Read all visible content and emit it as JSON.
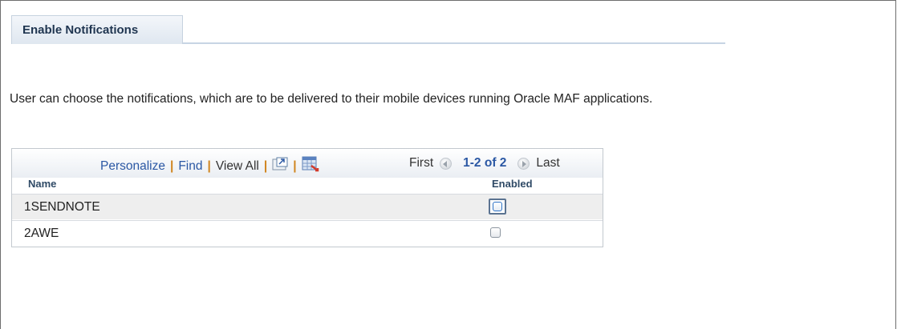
{
  "tab": {
    "label": "Enable Notifications"
  },
  "description": "User can choose the notifications, which are to be delivered to their mobile devices running Oracle MAF applications.",
  "grid": {
    "toolbar": {
      "personalize": "Personalize",
      "find": "Find",
      "view_all": "View All",
      "separator": "|",
      "zoom_icon": "zoom-icon",
      "download_icon": "download-spreadsheet-icon"
    },
    "pager": {
      "first": "First",
      "range": "1-2 of 2",
      "last": "Last"
    },
    "columns": {
      "name": "Name",
      "enabled": "Enabled"
    },
    "rows": [
      {
        "name": "1SENDNOTE",
        "enabled": false
      },
      {
        "name": "2AWE",
        "enabled": false
      }
    ]
  },
  "colors": {
    "link": "#2b58a4",
    "separator": "#d0851f",
    "header_text": "#2f4a66",
    "row_highlight": "#eeeeee"
  }
}
